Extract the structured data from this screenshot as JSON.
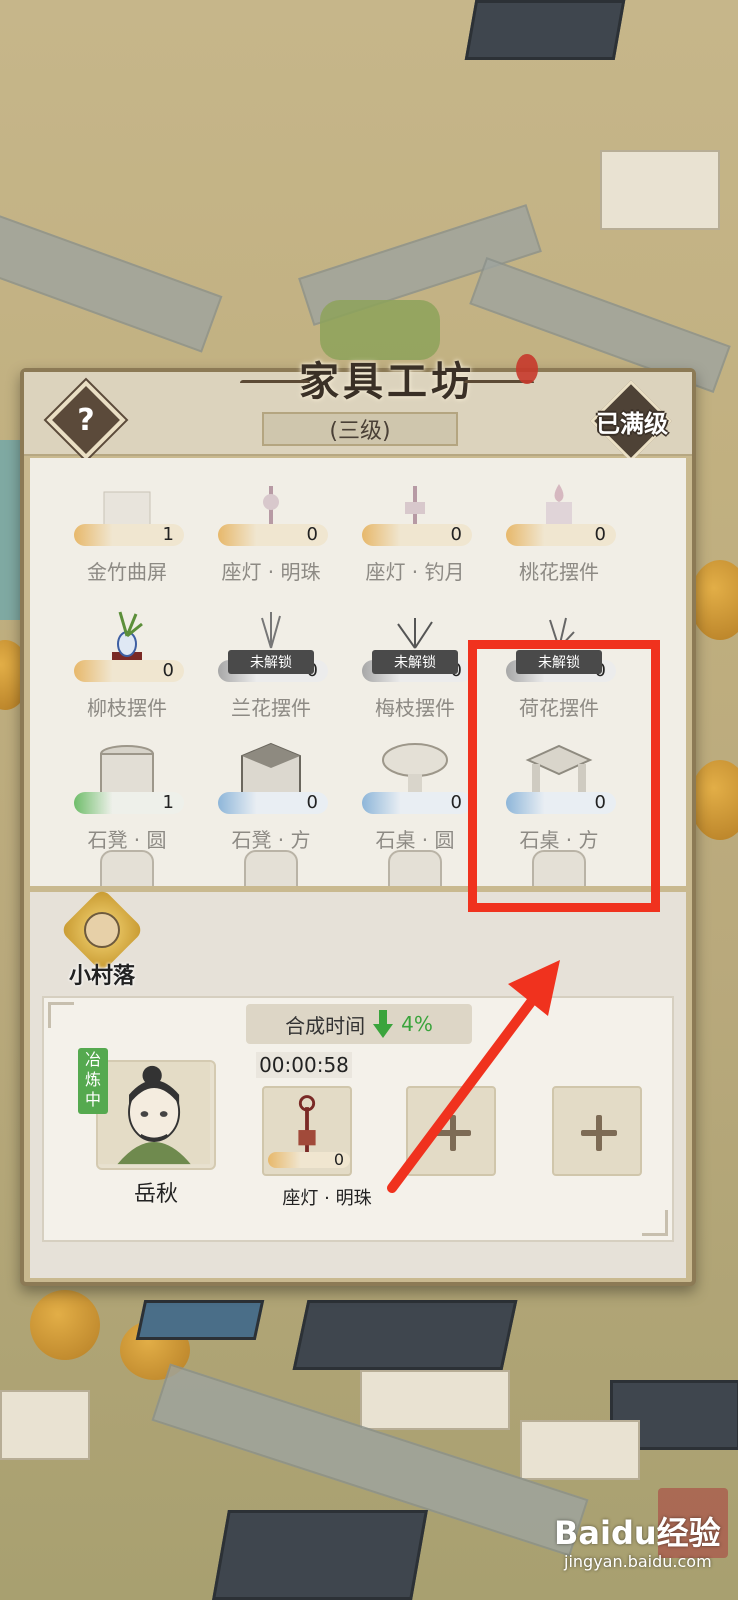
{
  "workshop": {
    "title": "家具工坊",
    "level_label": "(三级)",
    "max_level_badge": "已满级",
    "help_label": "?"
  },
  "items": [
    {
      "name": "金竹曲屏",
      "count": "1",
      "bar": "gold",
      "locked": false
    },
    {
      "name": "座灯 · 明珠",
      "count": "0",
      "bar": "gold",
      "locked": false
    },
    {
      "name": "座灯 · 钓月",
      "count": "0",
      "bar": "gold",
      "locked": false
    },
    {
      "name": "桃花摆件",
      "count": "0",
      "bar": "gold",
      "locked": false
    },
    {
      "name": "柳枝摆件",
      "count": "0",
      "bar": "gold",
      "locked": false
    },
    {
      "name": "兰花摆件",
      "count": "0",
      "bar": "gray",
      "locked": true
    },
    {
      "name": "梅枝摆件",
      "count": "0",
      "bar": "gray",
      "locked": true
    },
    {
      "name": "荷花摆件",
      "count": "0",
      "bar": "gray",
      "locked": true
    },
    {
      "name": "石凳 · 圆",
      "count": "1",
      "bar": "green",
      "locked": false
    },
    {
      "name": "石凳 · 方",
      "count": "0",
      "bar": "blue",
      "locked": false
    },
    {
      "name": "石桌 · 圆",
      "count": "0",
      "bar": "blue",
      "locked": false
    },
    {
      "name": "石桌 · 方",
      "count": "0",
      "bar": "blue",
      "locked": false
    }
  ],
  "lock_label": "未解锁",
  "village": {
    "label": "小村落"
  },
  "crafting": {
    "time_label": "合成时间",
    "time_bonus": "4%",
    "worker_status": "冶炼中",
    "worker_name": "岳秋",
    "timer": "00:00:58",
    "slot_item_name": "座灯 · 明珠",
    "slot_item_count": "0"
  },
  "watermark": {
    "logo": "Baidu经验",
    "sub": "jingyan.baidu.com"
  },
  "colors": {
    "highlight": "#f0321e",
    "bonus_green": "#3aa43c"
  }
}
